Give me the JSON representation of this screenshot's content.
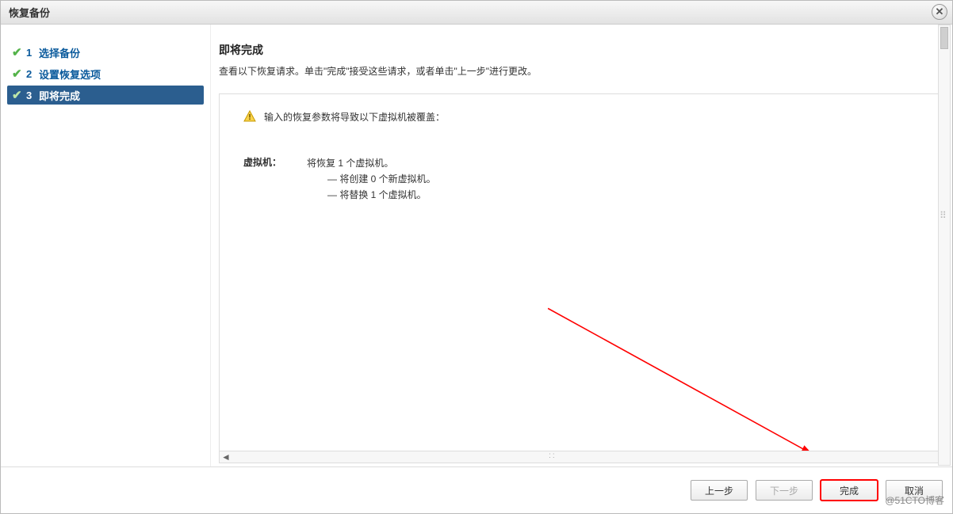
{
  "window": {
    "title": "恢复备份"
  },
  "steps": [
    {
      "num": "1",
      "label": "选择备份",
      "done": true,
      "active": false
    },
    {
      "num": "2",
      "label": "设置恢复选项",
      "done": true,
      "active": false
    },
    {
      "num": "3",
      "label": "即将完成",
      "done": true,
      "active": true
    }
  ],
  "main": {
    "heading": "即将完成",
    "subheading": "查看以下恢复请求。单击\"完成\"接受这些请求，或者单击\"上一步\"进行更改。"
  },
  "warning_text": "输入的恢复参数将导致以下虚拟机被覆盖：",
  "vm": {
    "label": "虚拟机：",
    "line1": "将恢复 1 个虚拟机。",
    "line2": "— 将创建 0 个新虚拟机。",
    "line3": "— 将替换 1 个虚拟机。"
  },
  "buttons": {
    "back": "上一步",
    "next": "下一步",
    "finish": "完成",
    "cancel": "取消"
  },
  "watermark": "@51CTO博客"
}
